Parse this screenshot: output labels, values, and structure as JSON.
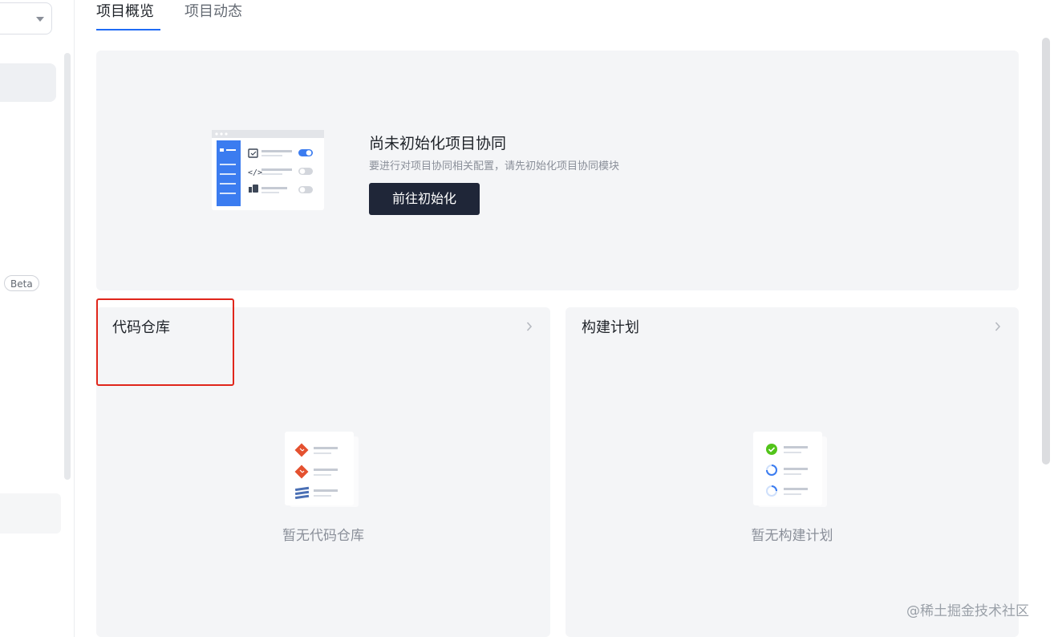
{
  "sidebar": {
    "badge": "Beta"
  },
  "tabs": [
    {
      "label": "项目概览",
      "active": true
    },
    {
      "label": "项目动态",
      "active": false
    }
  ],
  "banner": {
    "title": "尚未初始化项目协同",
    "description": "要进行对项目协同相关配置，请先初始化项目协同模块",
    "button_label": "前往初始化"
  },
  "cards": {
    "repo": {
      "title": "代码仓库",
      "empty_text": "暂无代码仓库",
      "icon": "git-repo-illustration"
    },
    "build": {
      "title": "构建计划",
      "empty_text": "暂无构建计划",
      "icon": "build-plan-illustration"
    }
  },
  "watermark": "@稀土掘金技术社区",
  "colors": {
    "accent": "#1f6bf5",
    "button": "#1f2638",
    "highlight": "#e0261b",
    "card_bg": "#f4f5f7"
  }
}
